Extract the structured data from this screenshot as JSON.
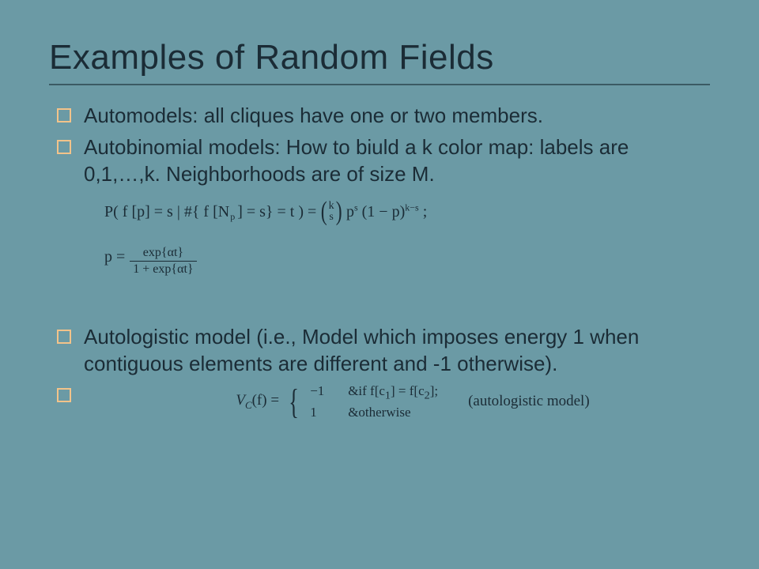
{
  "title": "Examples of Random Fields",
  "bullets": {
    "b1": "Automodels:  all cliques have one or two members.",
    "b2": "Autobinomial models: How to biuld a k color map: labels are 0,1,…,k.  Neighborhoods are of size M.",
    "b3": "Autologistic model (i.e., Model which imposes energy 1 when contiguous elements are different and -1 otherwise).",
    "b4": ""
  },
  "formula1": {
    "lhs": "P( f [p] = s | #{ f [N",
    "sub1": "p",
    "mid": "] = s} = t ) =",
    "binom_top": "k",
    "binom_bot": "s",
    "p_s": "p",
    "exp_s": "s",
    "one_minus_p": "(1 − p)",
    "exp_ks": "k−s",
    "semicolon": ";"
  },
  "formula2": {
    "p_eq": "p =",
    "num": "exp{αt}",
    "den": "1 + exp{αt}"
  },
  "vc": {
    "lhs_V": "V",
    "lhs_C": "C",
    "lhs_arg": "(f) =",
    "case1_val": "−1",
    "case1_cond": "&if   f[c",
    "case1_sub1": "1",
    "case1_mid": "] = f[c",
    "case1_sub2": "2",
    "case1_end": "];",
    "case2_val": "1",
    "case2_cond": "&otherwise",
    "tag": "(autologistic model)"
  }
}
